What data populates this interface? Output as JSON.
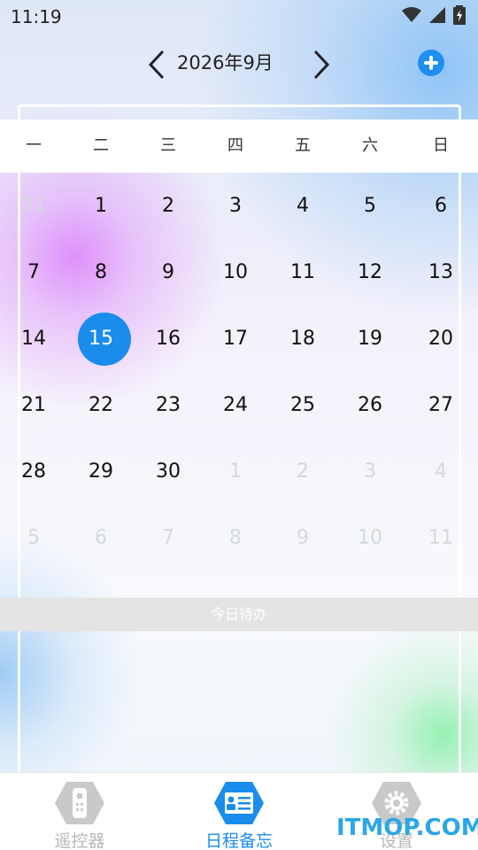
{
  "status_bar": {
    "time": "11:19"
  },
  "header": {
    "month_label": "2026年9月"
  },
  "weekdays": [
    "一",
    "二",
    "三",
    "四",
    "五",
    "六",
    "日"
  ],
  "calendar": {
    "selected_day": "15",
    "rows": [
      [
        {
          "d": "31",
          "dim": true
        },
        {
          "d": "1"
        },
        {
          "d": "2"
        },
        {
          "d": "3"
        },
        {
          "d": "4"
        },
        {
          "d": "5"
        },
        {
          "d": "6"
        }
      ],
      [
        {
          "d": "7"
        },
        {
          "d": "8"
        },
        {
          "d": "9"
        },
        {
          "d": "10"
        },
        {
          "d": "11"
        },
        {
          "d": "12"
        },
        {
          "d": "13"
        }
      ],
      [
        {
          "d": "14"
        },
        {
          "d": "15",
          "sel": true
        },
        {
          "d": "16"
        },
        {
          "d": "17"
        },
        {
          "d": "18"
        },
        {
          "d": "19"
        },
        {
          "d": "20"
        }
      ],
      [
        {
          "d": "21"
        },
        {
          "d": "22"
        },
        {
          "d": "23"
        },
        {
          "d": "24"
        },
        {
          "d": "25"
        },
        {
          "d": "26"
        },
        {
          "d": "27"
        }
      ],
      [
        {
          "d": "28"
        },
        {
          "d": "29"
        },
        {
          "d": "30"
        },
        {
          "d": "1",
          "dim": true
        },
        {
          "d": "2",
          "dim": true
        },
        {
          "d": "3",
          "dim": true
        },
        {
          "d": "4",
          "dim": true
        }
      ],
      [
        {
          "d": "5",
          "dim": true
        },
        {
          "d": "6",
          "dim": true
        },
        {
          "d": "7",
          "dim": true
        },
        {
          "d": "8",
          "dim": true
        },
        {
          "d": "9",
          "dim": true
        },
        {
          "d": "10",
          "dim": true
        },
        {
          "d": "11",
          "dim": true
        }
      ]
    ]
  },
  "todo": {
    "label": "今日待办"
  },
  "tabs": [
    {
      "label": "遥控器",
      "icon": "remote-icon",
      "active": false
    },
    {
      "label": "日程备忘",
      "icon": "schedule-icon",
      "active": true
    },
    {
      "label": "设置",
      "icon": "gear-icon",
      "active": false
    }
  ],
  "watermark": "ITMOP.COM",
  "colors": {
    "accent": "#1a8cec",
    "inactive": "#b8b8b8"
  }
}
